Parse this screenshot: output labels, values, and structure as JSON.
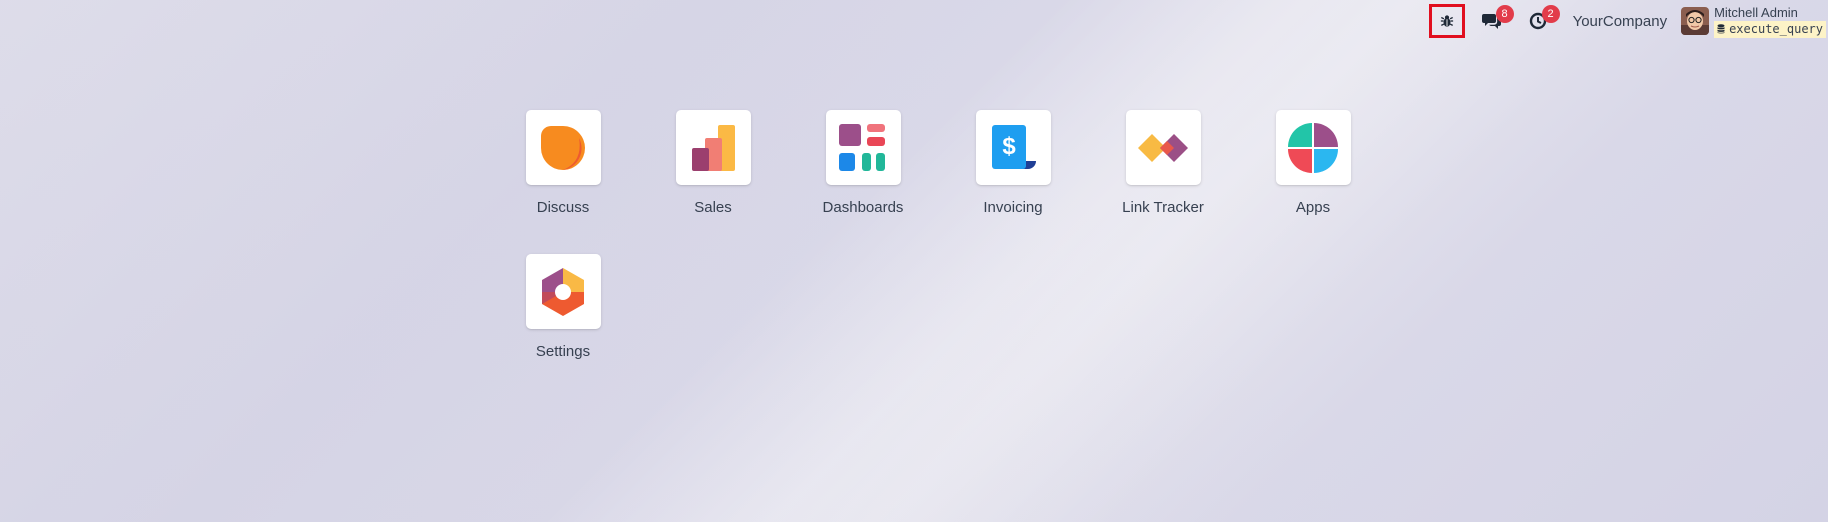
{
  "topbar": {
    "debug_icon": "bug-icon",
    "messages": {
      "icon": "chat-bubbles-icon",
      "count": "8"
    },
    "activities": {
      "icon": "clock-icon",
      "count": "2"
    },
    "company": "YourCompany",
    "user": {
      "name": "Mitchell Admin",
      "database": "execute_query",
      "db_icon": "database-icon"
    }
  },
  "apps": [
    {
      "label": "Discuss",
      "icon": "discuss-icon"
    },
    {
      "label": "Sales",
      "icon": "sales-icon"
    },
    {
      "label": "Dashboards",
      "icon": "dashboards-icon"
    },
    {
      "label": "Invoicing",
      "icon": "invoicing-icon"
    },
    {
      "label": "Link Tracker",
      "icon": "link-tracker-icon"
    },
    {
      "label": "Apps",
      "icon": "apps-icon"
    },
    {
      "label": "Settings",
      "icon": "settings-icon"
    }
  ],
  "colors": {
    "badge": "#e23c4a",
    "debug_highlight": "#e10f1f",
    "db_tag_bg": "#fdf3c7"
  }
}
